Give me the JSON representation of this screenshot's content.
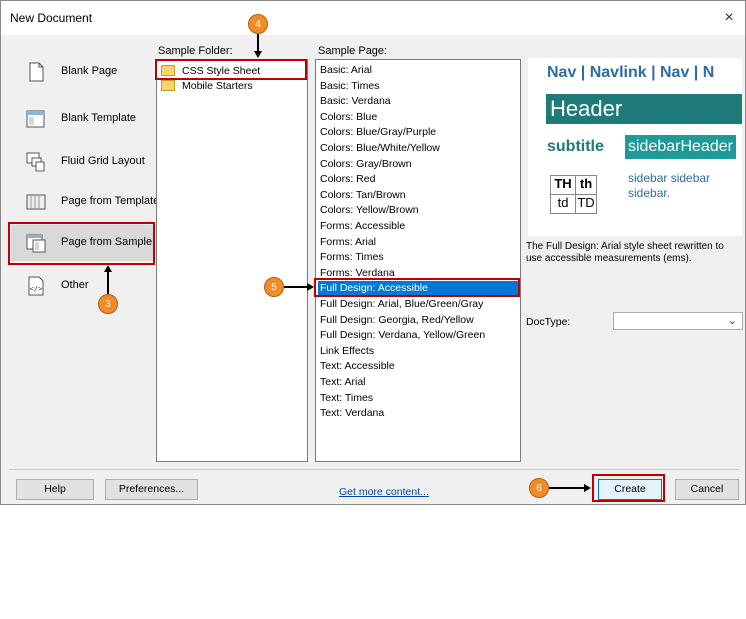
{
  "window": {
    "title": "New Document",
    "close_glyph": "×"
  },
  "categories": [
    {
      "label": "Blank Page",
      "icon": "blank-page-icon"
    },
    {
      "label": "Blank Template",
      "icon": "blank-template-icon"
    },
    {
      "label": "Fluid Grid Layout",
      "icon": "fluid-grid-icon"
    },
    {
      "label": "Page from Template",
      "icon": "page-from-template-icon"
    },
    {
      "label": "Page from Sample",
      "icon": "page-from-sample-icon",
      "selected": true
    },
    {
      "label": "Other",
      "icon": "other-code-icon"
    }
  ],
  "sample_folder": {
    "label": "Sample Folder:",
    "items": [
      "CSS Style Sheet",
      "Mobile Starters"
    ],
    "selected": "CSS Style Sheet"
  },
  "sample_page": {
    "label": "Sample Page:",
    "items": [
      "Basic: Arial",
      "Basic: Times",
      "Basic: Verdana",
      "Colors: Blue",
      "Colors: Blue/Gray/Purple",
      "Colors: Blue/White/Yellow",
      "Colors: Gray/Brown",
      "Colors: Red",
      "Colors: Tan/Brown",
      "Colors: Yellow/Brown",
      "Forms: Accessible",
      "Forms: Arial",
      "Forms: Times",
      "Forms: Verdana",
      "Full Design: Accessible",
      "Full Design: Arial, Blue/Green/Gray",
      "Full Design: Georgia, Red/Yellow",
      "Full Design: Verdana, Yellow/Green",
      "Link Effects",
      "Text: Accessible",
      "Text: Arial",
      "Text: Times",
      "Text: Verdana"
    ],
    "selected": "Full Design: Accessible"
  },
  "preview": {
    "nav": "Nav | Navlink | Nav | N",
    "header": "Header",
    "subtitle": "subtitle",
    "sidebar_header": "sidebarHeader",
    "th1": "TH",
    "th2": "th",
    "td1": "td",
    "td2": "TD",
    "sidebar_line1": "sidebar sidebar",
    "sidebar_line2": "sidebar."
  },
  "description": "The Full Design: Arial style sheet rewritten to use accessible measurements (ems).",
  "doctype": {
    "label": "DocType:",
    "value": ""
  },
  "footer": {
    "help": "Help",
    "preferences": "Preferences...",
    "get_more": "Get more content...",
    "create": "Create",
    "cancel": "Cancel"
  },
  "annotations": [
    "3",
    "4",
    "5",
    "6"
  ],
  "colors": {
    "selection": "#0078d7",
    "highlight_box": "#c00000",
    "badge": "#f28c28"
  }
}
